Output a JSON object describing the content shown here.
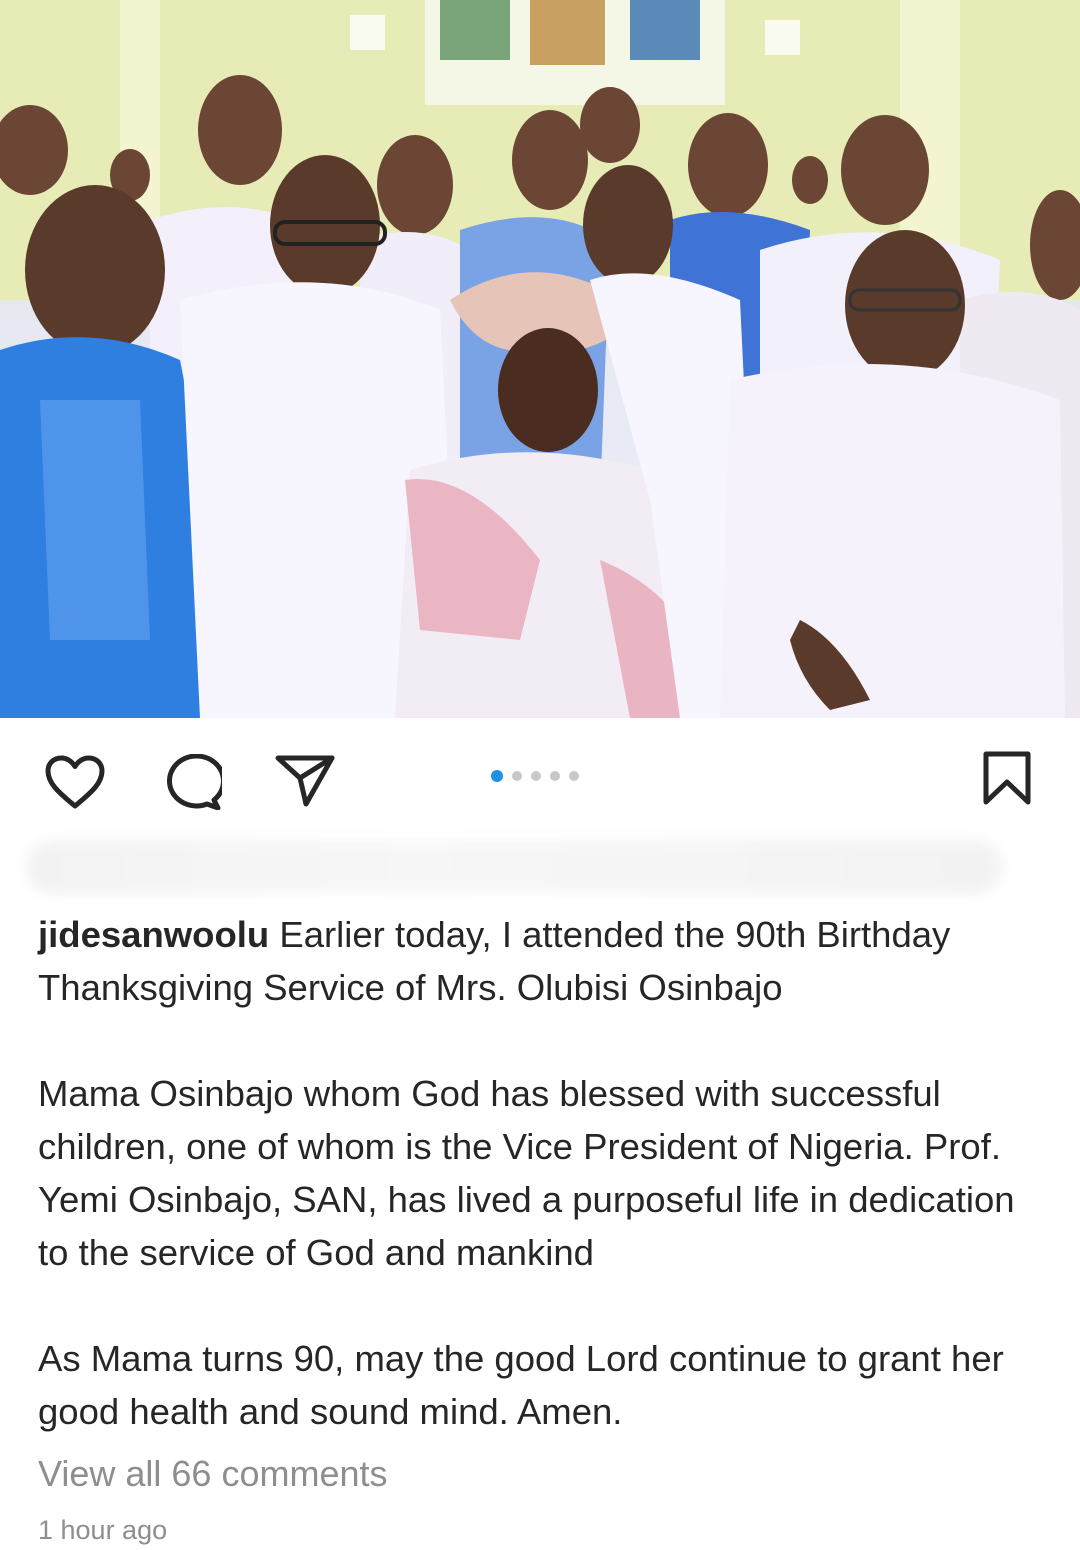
{
  "post": {
    "image_alt": "Group photo of men in white and blue agbada surrounding an elderly woman in a pink gele at a church thanksgiving service",
    "carousel": {
      "count": 5,
      "active_index": 0
    },
    "username": "jidesanwoolu",
    "caption_lines": {
      "p1": "Earlier today, I attended the 90th Birthday Thanksgiving Service of Mrs. Olubisi Osinbajo",
      "p2": "Mama Osinbajo whom God has blessed with successful children, one of whom is the Vice President of Nigeria. Prof. Yemi Osinbajo, SAN, has lived a purposeful life in dedication to the service of God and mankind",
      "p3": "As Mama turns 90, may the good Lord continue to grant her good health and sound mind. Amen."
    },
    "view_comments": "View all 66 comments",
    "timestamp": "1 hour ago"
  },
  "icons": {
    "like": "heart-icon",
    "comment": "comment-bubble-icon",
    "share": "paper-plane-icon",
    "save": "bookmark-icon"
  },
  "colors": {
    "accent": "#1e90e6",
    "text": "#262626",
    "muted": "#8e8e8e"
  }
}
